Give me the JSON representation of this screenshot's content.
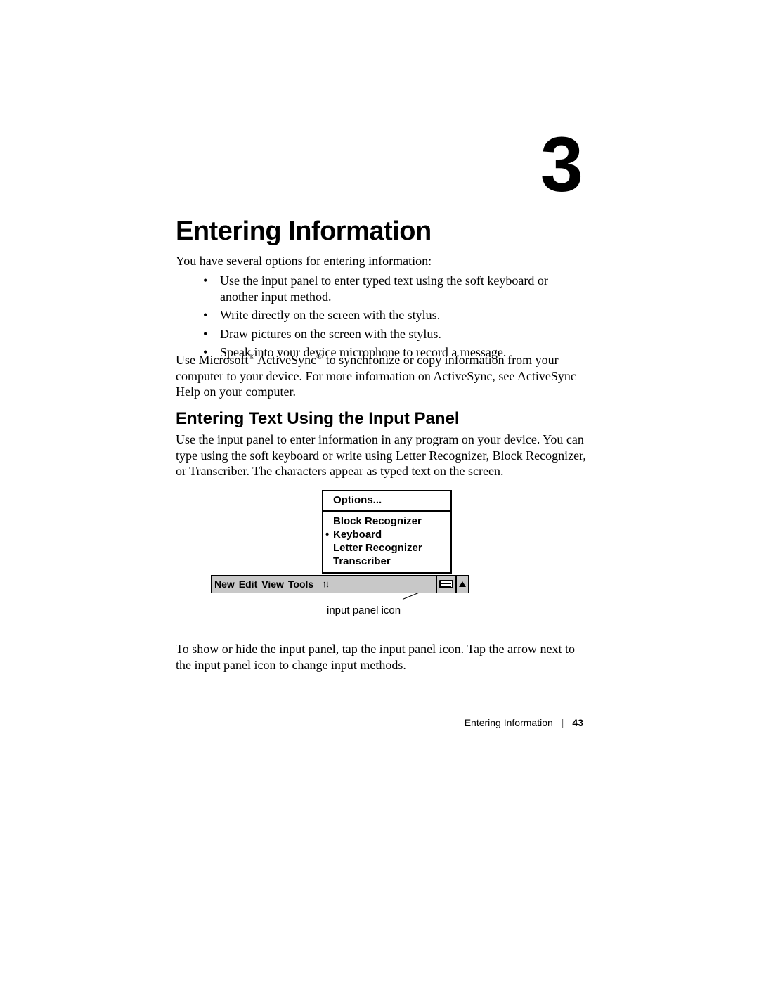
{
  "chapter_number": "3",
  "h1": "Entering Information",
  "intro": "You have several options for entering information:",
  "bullets": [
    "Use the input panel to enter typed text using the soft keyboard or another input method.",
    "Write directly on the screen with the stylus.",
    "Draw pictures on the screen with the stylus.",
    "Speak into your device microphone to record a message."
  ],
  "para2_parts": {
    "a": "Use Microsoft",
    "b": " ActiveSync",
    "c": " to synchronize or copy information from your computer to your device. For more information on ActiveSync, see ActiveSync Help on your computer."
  },
  "reg": "®",
  "h2": "Entering Text Using the Input Panel",
  "para3": "Use the input panel to enter information in any program on your device. You can type using the soft keyboard or write using Letter Recognizer, Block Recognizer, or Transcriber. The characters appear as typed text on the screen.",
  "figure": {
    "popup_top": "Options...",
    "popup_items": [
      {
        "label": "Block Recognizer",
        "selected": false
      },
      {
        "label": "Keyboard",
        "selected": true
      },
      {
        "label": "Letter Recognizer",
        "selected": false
      },
      {
        "label": "Transcriber",
        "selected": false
      }
    ],
    "taskbar_items": [
      "New",
      "Edit",
      "View",
      "Tools"
    ],
    "callout": "input panel icon"
  },
  "para4": "To show or hide the input panel, tap the input panel icon. Tap the arrow next to the input panel icon to change input methods.",
  "footer": {
    "section": "Entering Information",
    "page": "43"
  }
}
